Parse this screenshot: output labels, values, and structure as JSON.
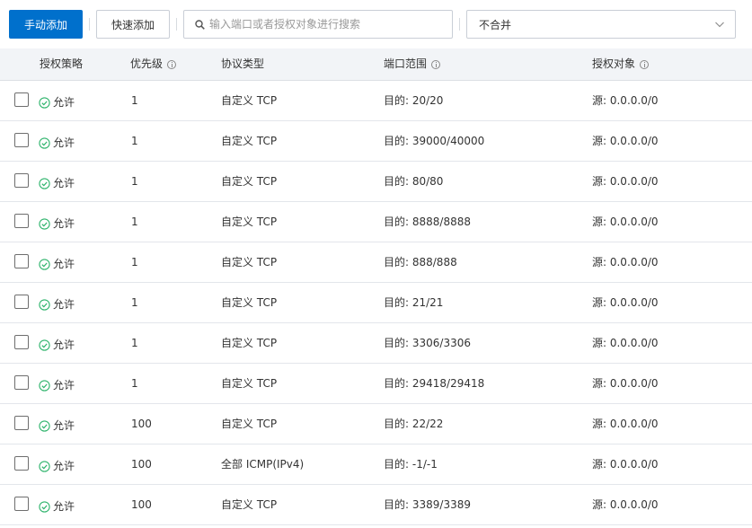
{
  "toolbar": {
    "manual_add_label": "手动添加",
    "quick_add_label": "快速添加",
    "search_placeholder": "输入端口或者授权对象进行搜索",
    "merge_select_value": "不合并"
  },
  "table": {
    "columns": {
      "policy": "授权策略",
      "priority": "优先级",
      "protocol": "协议类型",
      "port_range": "端口范围",
      "auth_object": "授权对象"
    },
    "rows": [
      {
        "policy": "允许",
        "priority": "1",
        "protocol": "自定义 TCP",
        "port": "目的: 20/20",
        "source": "源: 0.0.0.0/0"
      },
      {
        "policy": "允许",
        "priority": "1",
        "protocol": "自定义 TCP",
        "port": "目的: 39000/40000",
        "source": "源: 0.0.0.0/0"
      },
      {
        "policy": "允许",
        "priority": "1",
        "protocol": "自定义 TCP",
        "port": "目的: 80/80",
        "source": "源: 0.0.0.0/0"
      },
      {
        "policy": "允许",
        "priority": "1",
        "protocol": "自定义 TCP",
        "port": "目的: 8888/8888",
        "source": "源: 0.0.0.0/0"
      },
      {
        "policy": "允许",
        "priority": "1",
        "protocol": "自定义 TCP",
        "port": "目的: 888/888",
        "source": "源: 0.0.0.0/0"
      },
      {
        "policy": "允许",
        "priority": "1",
        "protocol": "自定义 TCP",
        "port": "目的: 21/21",
        "source": "源: 0.0.0.0/0"
      },
      {
        "policy": "允许",
        "priority": "1",
        "protocol": "自定义 TCP",
        "port": "目的: 3306/3306",
        "source": "源: 0.0.0.0/0"
      },
      {
        "policy": "允许",
        "priority": "1",
        "protocol": "自定义 TCP",
        "port": "目的: 29418/29418",
        "source": "源: 0.0.0.0/0"
      },
      {
        "policy": "允许",
        "priority": "100",
        "protocol": "自定义 TCP",
        "port": "目的: 22/22",
        "source": "源: 0.0.0.0/0"
      },
      {
        "policy": "允许",
        "priority": "100",
        "protocol": "全部 ICMP(IPv4)",
        "port": "目的: -1/-1",
        "source": "源: 0.0.0.0/0"
      },
      {
        "policy": "允许",
        "priority": "100",
        "protocol": "自定义 TCP",
        "port": "目的: 3389/3389",
        "source": "源: 0.0.0.0/0"
      }
    ]
  },
  "colors": {
    "primary": "#0070cc",
    "allow_green": "#2db36b",
    "header_bg": "#f2f4f7"
  },
  "icons": {
    "search": "search-icon",
    "dropdown": "chevron-down-icon",
    "info": "info-icon",
    "allow": "check-circle-icon"
  }
}
